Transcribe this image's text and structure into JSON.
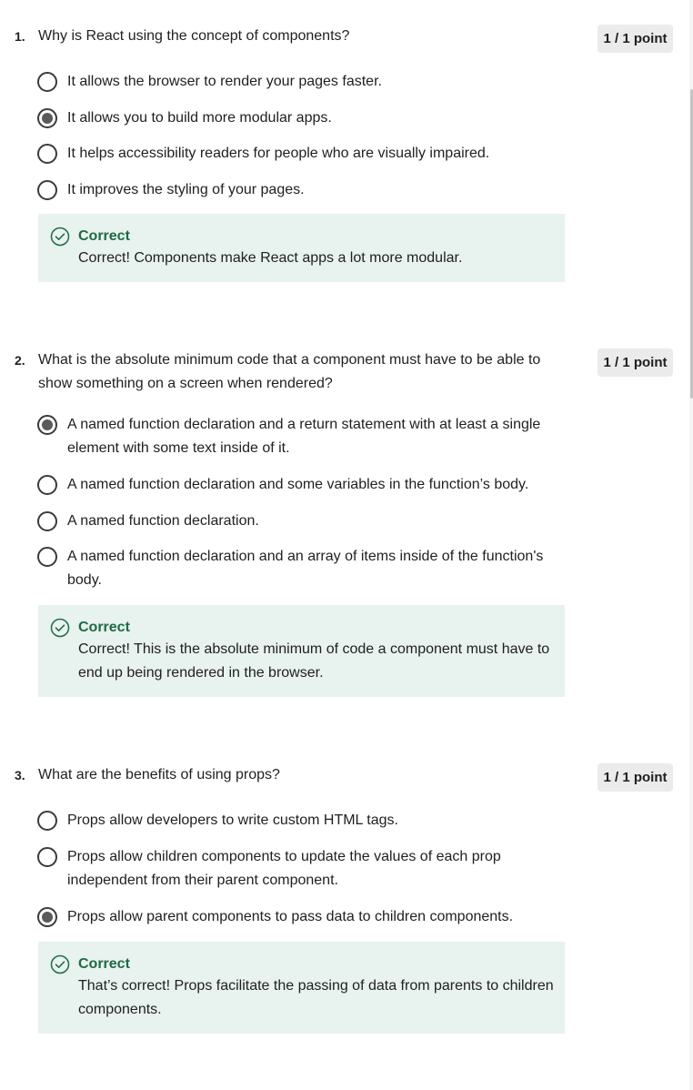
{
  "questions": [
    {
      "number": "1.",
      "text": "Why is React using the concept of components?",
      "points": "1 / 1 point",
      "options": [
        {
          "label": "It allows the browser to render your pages faster.",
          "selected": false
        },
        {
          "label": "It allows you to build more modular apps.",
          "selected": true
        },
        {
          "label": "It helps accessibility readers for people who are visually impaired.",
          "selected": false
        },
        {
          "label": "It improves the styling of your pages.",
          "selected": false
        }
      ],
      "feedback": {
        "icon": "check-circle-icon",
        "title": "Correct",
        "text": "Correct! Components make React apps a lot more modular."
      }
    },
    {
      "number": "2.",
      "text": "What is the absolute minimum code that a component must have to be able to show something on a screen when rendered?",
      "points": "1 / 1 point",
      "options": [
        {
          "label": "A named function declaration and a return statement with at least a single element with some text inside of it.",
          "selected": true
        },
        {
          "label": "A named function declaration and some variables in the function’s body.",
          "selected": false
        },
        {
          "label": "A named function declaration.",
          "selected": false
        },
        {
          "label": "A named function declaration and an array of items inside of the function's body.",
          "selected": false
        }
      ],
      "feedback": {
        "icon": "check-circle-icon",
        "title": "Correct",
        "text": "Correct! This is the absolute minimum of code a component must have to end up being rendered in the browser."
      }
    },
    {
      "number": "3.",
      "text": "What are the benefits of using props?",
      "points": "1 / 1 point",
      "options": [
        {
          "label": "Props allow developers to write custom HTML tags.",
          "selected": false
        },
        {
          "label": "Props allow children components to update the values of each prop independent from their parent component.",
          "selected": false
        },
        {
          "label": "Props allow parent components to pass data to children components.",
          "selected": true
        }
      ],
      "feedback": {
        "icon": "check-circle-icon",
        "title": "Correct",
        "text": "That’s correct! Props facilitate the passing of data from parents to children components."
      }
    }
  ],
  "colors": {
    "correct_green": "#1e6b45",
    "feedback_bg": "#e8f2ee",
    "badge_bg": "#ebebeb"
  }
}
